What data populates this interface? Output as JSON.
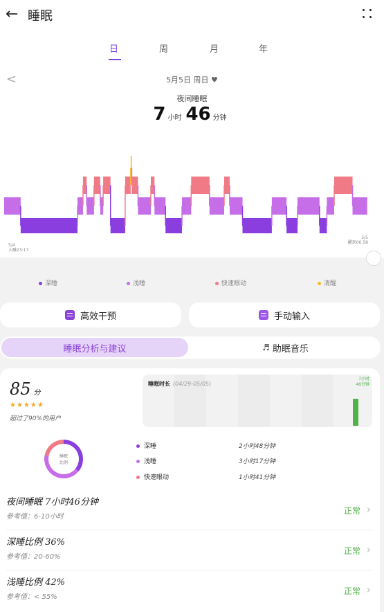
{
  "header": {
    "back_icon": "←",
    "title": "睡眠"
  },
  "tabs": [
    "日",
    "周",
    "月",
    "年"
  ],
  "date": {
    "prev_icon": "<",
    "text": "5月5日 周日 ♥"
  },
  "summary": {
    "type": "夜间睡眠",
    "hours": "7",
    "hours_unit": "小时",
    "minutes": "46",
    "minutes_unit": "分钟"
  },
  "chart_axis": {
    "start_date": "5/4",
    "start_label": "入睡23:17",
    "end_date": "5/5",
    "end_label": "醒来06:58"
  },
  "colors": {
    "deep": "#8a3ee0",
    "light": "#c56ee8",
    "rem": "#f07a86",
    "awake": "#f5b92a",
    "accent": "#7a3fe0",
    "normal": "#52b24a"
  },
  "chart_data": {
    "type": "hypnogram",
    "stages": [
      "清醒",
      "快速眼动",
      "浅睡",
      "深睡"
    ],
    "x_start": "23:17",
    "x_end": "06:58",
    "segments": [
      {
        "stage": "浅睡",
        "from": 0.0,
        "to": 0.045
      },
      {
        "stage": "深睡",
        "from": 0.045,
        "to": 0.2
      },
      {
        "stage": "浅睡",
        "from": 0.2,
        "to": 0.215
      },
      {
        "stage": "快速眼动",
        "from": 0.215,
        "to": 0.225
      },
      {
        "stage": "浅睡",
        "from": 0.225,
        "to": 0.245
      },
      {
        "stage": "快速眼动",
        "from": 0.245,
        "to": 0.262
      },
      {
        "stage": "浅睡",
        "from": 0.262,
        "to": 0.27
      },
      {
        "stage": "快速眼动",
        "from": 0.27,
        "to": 0.29
      },
      {
        "stage": "深睡",
        "from": 0.29,
        "to": 0.33
      },
      {
        "stage": "快速眼动",
        "from": 0.33,
        "to": 0.345
      },
      {
        "stage": "清醒",
        "from": 0.345,
        "to": 0.348
      },
      {
        "stage": "快速眼动",
        "from": 0.348,
        "to": 0.365
      },
      {
        "stage": "浅睡",
        "from": 0.365,
        "to": 0.4
      },
      {
        "stage": "快速眼动",
        "from": 0.4,
        "to": 0.41
      },
      {
        "stage": "浅睡",
        "from": 0.41,
        "to": 0.44
      },
      {
        "stage": "深睡",
        "from": 0.44,
        "to": 0.485
      },
      {
        "stage": "浅睡",
        "from": 0.485,
        "to": 0.51
      },
      {
        "stage": "快速眼动",
        "from": 0.51,
        "to": 0.56
      },
      {
        "stage": "浅睡",
        "from": 0.56,
        "to": 0.6
      },
      {
        "stage": "快速眼动",
        "from": 0.6,
        "to": 0.615
      },
      {
        "stage": "浅睡",
        "from": 0.615,
        "to": 0.65
      },
      {
        "stage": "深睡",
        "from": 0.65,
        "to": 0.73
      },
      {
        "stage": "浅睡",
        "from": 0.73,
        "to": 0.77
      },
      {
        "stage": "深睡",
        "from": 0.77,
        "to": 0.8
      },
      {
        "stage": "浅睡",
        "from": 0.8,
        "to": 0.86
      },
      {
        "stage": "深睡",
        "from": 0.86,
        "to": 0.88
      },
      {
        "stage": "浅睡",
        "from": 0.88,
        "to": 0.9
      },
      {
        "stage": "快速眼动",
        "from": 0.9,
        "to": 0.95
      },
      {
        "stage": "浅睡",
        "from": 0.95,
        "to": 0.99
      }
    ]
  },
  "legend": [
    {
      "label": "深睡",
      "color": "#8a3ee0"
    },
    {
      "label": "浅睡",
      "color": "#c56ee8"
    },
    {
      "label": "快速眼动",
      "color": "#f07a86"
    },
    {
      "label": "清醒",
      "color": "#f5b92a"
    }
  ],
  "actions": {
    "efficient_intervention": "高效干预",
    "manual_input": "手动输入"
  },
  "segment": {
    "analysis": "睡眠分析与建议",
    "music": "助眠音乐"
  },
  "score": {
    "value": "85",
    "unit": "分",
    "stars": "★★★★★",
    "star_rating": 4.5,
    "beat_text": "超过了90%的用户"
  },
  "duration_chart": {
    "title": "睡眠时长",
    "range": "(04/29-05/05)",
    "value_line1": "7小时",
    "value_line2": "46分钟",
    "value_hours": 7.77
  },
  "ratio": {
    "donut_label_line1": "睡眠",
    "donut_label_line2": "比例",
    "rows": [
      {
        "label": "深睡",
        "value": "2小时48分钟",
        "color": "#8a3ee0",
        "minutes": 168
      },
      {
        "label": "浅睡",
        "value": "3小时17分钟",
        "color": "#c56ee8",
        "minutes": 197
      },
      {
        "label": "快速眼动",
        "value": "1小时41分钟",
        "color": "#f07a86",
        "minutes": 101
      }
    ]
  },
  "stats": [
    {
      "title": "夜间睡眠  7小时46分钟",
      "reference": "参考值：6-10小时",
      "status": "正常"
    },
    {
      "title": "深睡比例  36%",
      "reference": "参考值：20-60%",
      "status": "正常"
    },
    {
      "title": "浅睡比例  42%",
      "reference": "参考值：< 55%",
      "status": "正常"
    }
  ]
}
